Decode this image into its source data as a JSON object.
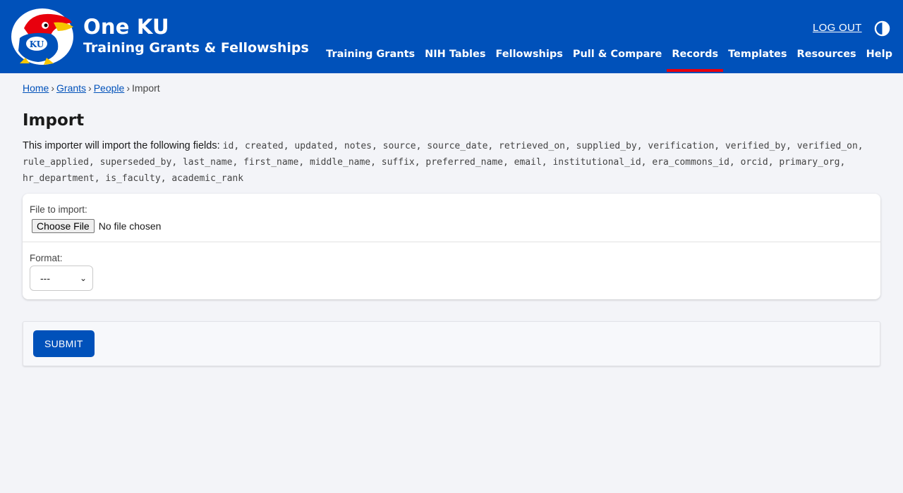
{
  "header": {
    "brand_title": "One KU",
    "brand_subtitle": "Training Grants & Fellowships",
    "logout_label": "LOG OUT",
    "logo_icon": "jayhawk-logo",
    "theme_icon": "contrast-toggle-icon",
    "nav": [
      {
        "label": "Training Grants",
        "active": false
      },
      {
        "label": "NIH Tables",
        "active": false
      },
      {
        "label": "Fellowships",
        "active": false
      },
      {
        "label": "Pull & Compare",
        "active": false
      },
      {
        "label": "Records",
        "active": true
      },
      {
        "label": "Templates",
        "active": false
      },
      {
        "label": "Resources",
        "active": false
      },
      {
        "label": "Help",
        "active": false
      }
    ],
    "accent_color": "#e8000d",
    "bar_color": "#0051ba"
  },
  "breadcrumb": {
    "items": [
      "Home",
      "Grants",
      "People"
    ],
    "current": "Import",
    "separator": "›"
  },
  "page": {
    "title": "Import",
    "description": "This importer will import the following fields:",
    "fields": [
      "id",
      "created",
      "updated",
      "notes",
      "source",
      "source_date",
      "retrieved_on",
      "supplied_by",
      "verification",
      "verified_by",
      "verified_on",
      "rule_applied",
      "superseded_by",
      "last_name",
      "first_name",
      "middle_name",
      "suffix",
      "preferred_name",
      "email",
      "institutional_id",
      "era_commons_id",
      "orcid",
      "primary_org",
      "hr_department",
      "is_faculty",
      "academic_rank"
    ]
  },
  "form": {
    "file_label": "File to import:",
    "file_button": "Choose File",
    "file_status": "No file chosen",
    "format_label": "Format:",
    "format_selected": "---",
    "submit_label": "SUBMIT"
  }
}
